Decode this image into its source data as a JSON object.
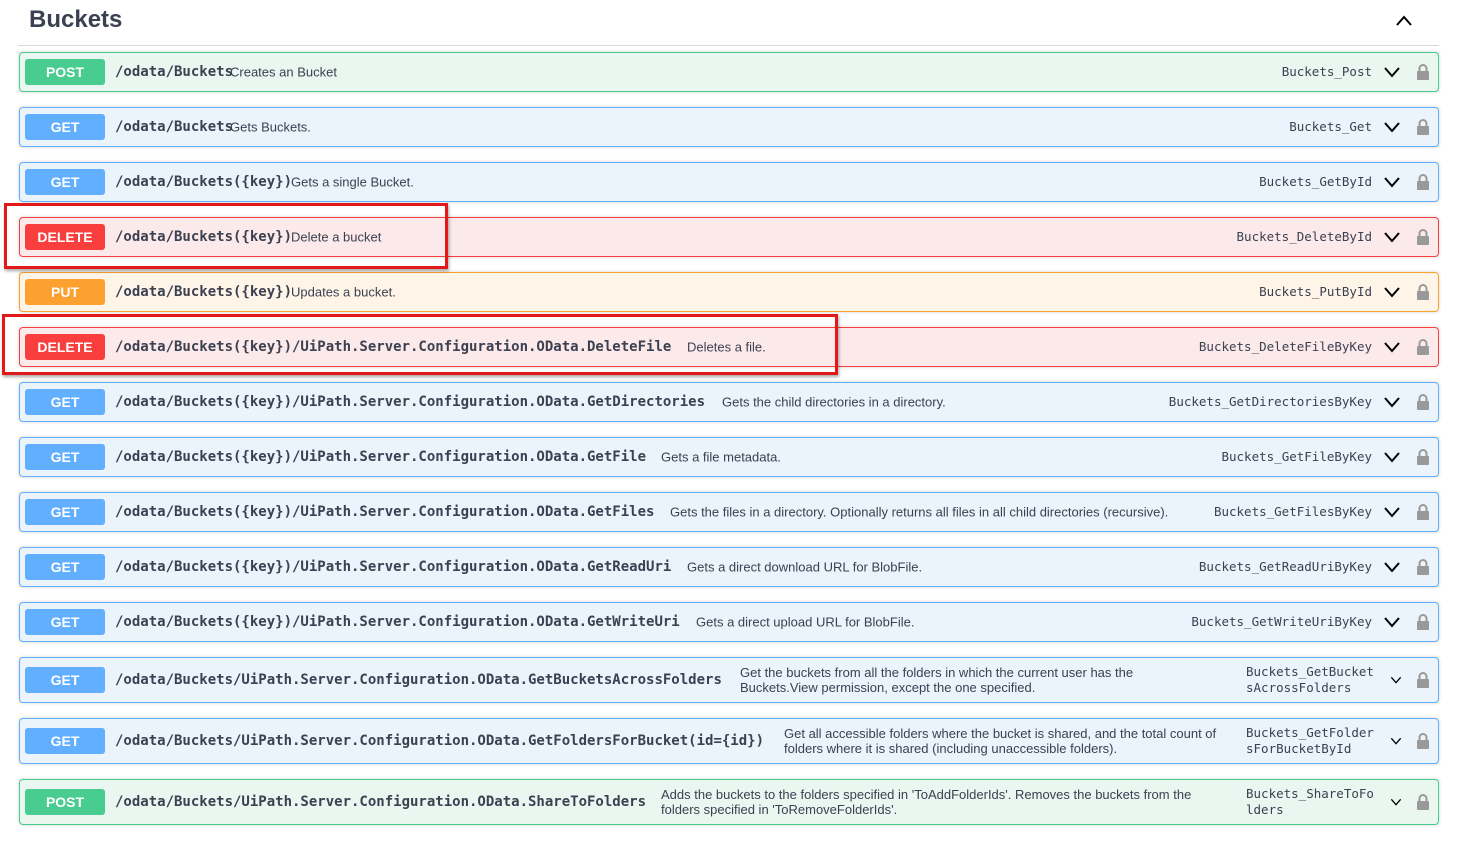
{
  "section": {
    "title": "Buckets",
    "collapse_icon": "chevron-up-icon"
  },
  "colors": {
    "post": "#49cc90",
    "get": "#61affe",
    "delete": "#f93e3e",
    "put": "#fca130",
    "highlight": "#e31818"
  },
  "icons": {
    "expand": "chevron-down-icon",
    "auth": "lock-icon"
  },
  "operations": [
    {
      "method": "POST",
      "path": "/odata/Buckets",
      "summary": "Creates an Bucket",
      "operation_id": "Buckets_Post"
    },
    {
      "method": "GET",
      "path": "/odata/Buckets",
      "summary": "Gets Buckets.",
      "operation_id": "Buckets_Get"
    },
    {
      "method": "GET",
      "path": "/odata/Buckets({key})",
      "summary": "Gets a single Bucket.",
      "operation_id": "Buckets_GetById"
    },
    {
      "method": "DELETE",
      "path": "/odata/Buckets({key})",
      "summary": "Delete a bucket",
      "operation_id": "Buckets_DeleteById",
      "highlighted": true
    },
    {
      "method": "PUT",
      "path": "/odata/Buckets({key})",
      "summary": "Updates a bucket.",
      "operation_id": "Buckets_PutById"
    },
    {
      "method": "DELETE",
      "path": "/odata/Buckets({key})/UiPath.Server.Configuration.OData.DeleteFile",
      "summary": "Deletes a file.",
      "operation_id": "Buckets_DeleteFileByKey",
      "highlighted": true
    },
    {
      "method": "GET",
      "path": "/odata/Buckets({key})/UiPath.Server.Configuration.OData.GetDirectories",
      "summary": "Gets the child directories in a directory.",
      "operation_id": "Buckets_GetDirectoriesByKey"
    },
    {
      "method": "GET",
      "path": "/odata/Buckets({key})/UiPath.Server.Configuration.OData.GetFile",
      "summary": "Gets a file metadata.",
      "operation_id": "Buckets_GetFileByKey"
    },
    {
      "method": "GET",
      "path": "/odata/Buckets({key})/UiPath.Server.Configuration.OData.GetFiles",
      "summary": "Gets the files in a directory. Optionally returns all files in all child directories (recursive).",
      "operation_id": "Buckets_GetFilesByKey"
    },
    {
      "method": "GET",
      "path": "/odata/Buckets({key})/UiPath.Server.Configuration.OData.GetReadUri",
      "summary": "Gets a direct download URL for BlobFile.",
      "operation_id": "Buckets_GetReadUriByKey"
    },
    {
      "method": "GET",
      "path": "/odata/Buckets({key})/UiPath.Server.Configuration.OData.GetWriteUri",
      "summary": "Gets a direct upload URL for BlobFile.",
      "operation_id": "Buckets_GetWriteUriByKey"
    },
    {
      "method": "GET",
      "path": "/odata/Buckets/UiPath.Server.Configuration.OData.GetBucketsAcrossFolders",
      "summary": "Get the buckets from all the folders in which the current user has the Buckets.View permission, except the one specified.",
      "operation_id": "Buckets_GetBucketsAcrossFolders"
    },
    {
      "method": "GET",
      "path": "/odata/Buckets/UiPath.Server.Configuration.OData.GetFoldersForBucket(id={id})",
      "summary": "Get all accessible folders where the bucket is shared, and the total count of folders where it is shared (including unaccessible folders).",
      "operation_id": "Buckets_GetFoldersForBucketById"
    },
    {
      "method": "POST",
      "path": "/odata/Buckets/UiPath.Server.Configuration.OData.ShareToFolders",
      "summary": "Adds the buckets to the folders specified in 'ToAddFolderIds'. Removes the buckets from the folders specified in 'ToRemoveFolderIds'.",
      "operation_id": "Buckets_ShareToFolders"
    }
  ]
}
